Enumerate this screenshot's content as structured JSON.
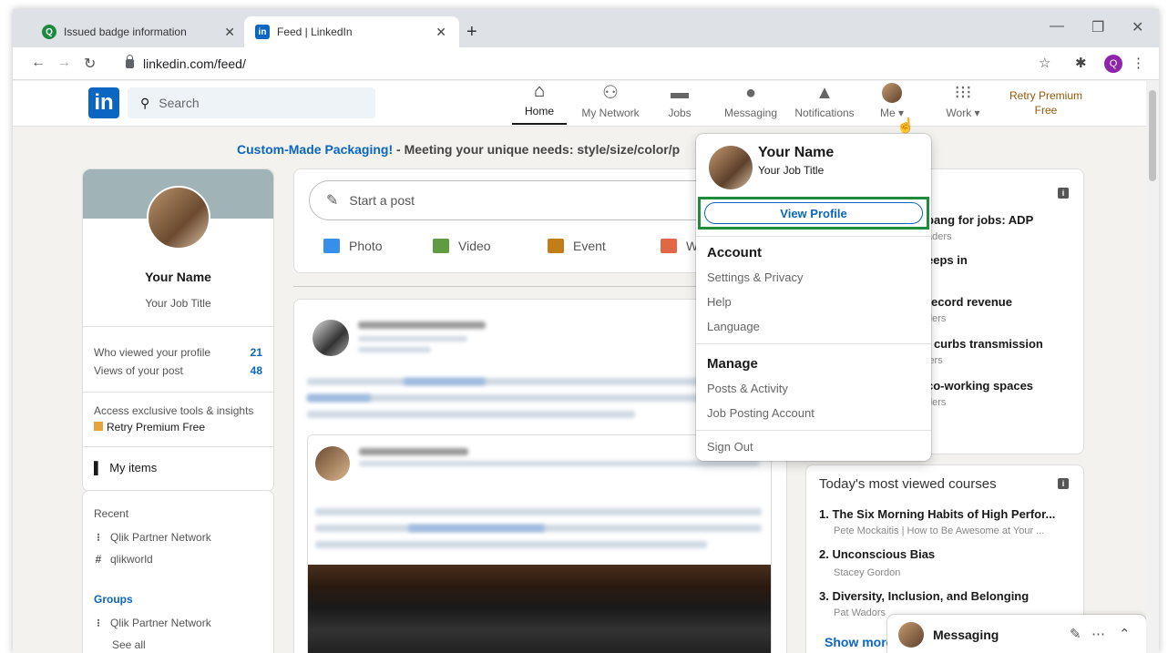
{
  "tabs": [
    {
      "title": "Issued badge information"
    },
    {
      "title": "Feed | LinkedIn"
    }
  ],
  "address": {
    "url": "linkedin.com/feed/",
    "profile_initial": "Q"
  },
  "header": {
    "search_placeholder": "Search",
    "nav": [
      {
        "label": "Home"
      },
      {
        "label": "My Network"
      },
      {
        "label": "Jobs"
      },
      {
        "label": "Messaging"
      },
      {
        "label": "Notifications"
      },
      {
        "label": "Me"
      },
      {
        "label": "Work"
      }
    ],
    "premium_line1": "Retry Premium",
    "premium_line2": "Free"
  },
  "ad": {
    "link": "Custom-Made Packaging!",
    "text": " - Meeting your unique needs: style/size/color/p"
  },
  "profile": {
    "name": "Your Name",
    "title": "Your Job Title",
    "stats": [
      {
        "label": "Who viewed your profile",
        "value": "21"
      },
      {
        "label": "Views of your post",
        "value": "48"
      }
    ],
    "premium_note": "Access exclusive tools & insights",
    "premium_link": "Retry Premium Free",
    "my_items": "My items"
  },
  "recent": {
    "heading": "Recent",
    "items": [
      "Qlik Partner Network",
      "qlikworld"
    ],
    "groups_heading": "Groups",
    "groups": [
      "Qlik Partner Network"
    ],
    "see_all": "See all"
  },
  "compose": {
    "placeholder": "Start a post",
    "actions": [
      "Photo",
      "Video",
      "Event",
      "W"
    ]
  },
  "dropdown": {
    "name": "Your Name",
    "title": "Your Job Title",
    "view_profile": "View Profile",
    "account_heading": "Account",
    "account_items": [
      "Settings & Privacy",
      "Help",
      "Language"
    ],
    "manage_heading": "Manage",
    "manage_items": [
      "Posts & Activity",
      "Job Posting Account"
    ],
    "sign_out": "Sign Out"
  },
  "news": [
    {
      "title": "bang for jobs: ADP",
      "sub": "aders"
    },
    {
      "title": "eeps in",
      "sub": "s"
    },
    {
      "title": "record revenue",
      "sub": "ders"
    },
    {
      "title": ": curbs transmission",
      "sub": "lers"
    },
    {
      "title": "co-working spaces",
      "sub": "ders"
    }
  ],
  "courses": {
    "heading": "Today's most viewed courses",
    "items": [
      {
        "title": "1. The Six Morning Habits of High Perfor...",
        "sub": "Pete Mockaitis | How to Be Awesome at Your ..."
      },
      {
        "title": "2. Unconscious Bias",
        "sub": "Stacey Gordon"
      },
      {
        "title": "3. Diversity, Inclusion, and Belonging",
        "sub": "Pat Wadors"
      }
    ],
    "show_more": "Show more"
  },
  "messaging": {
    "label": "Messaging"
  }
}
